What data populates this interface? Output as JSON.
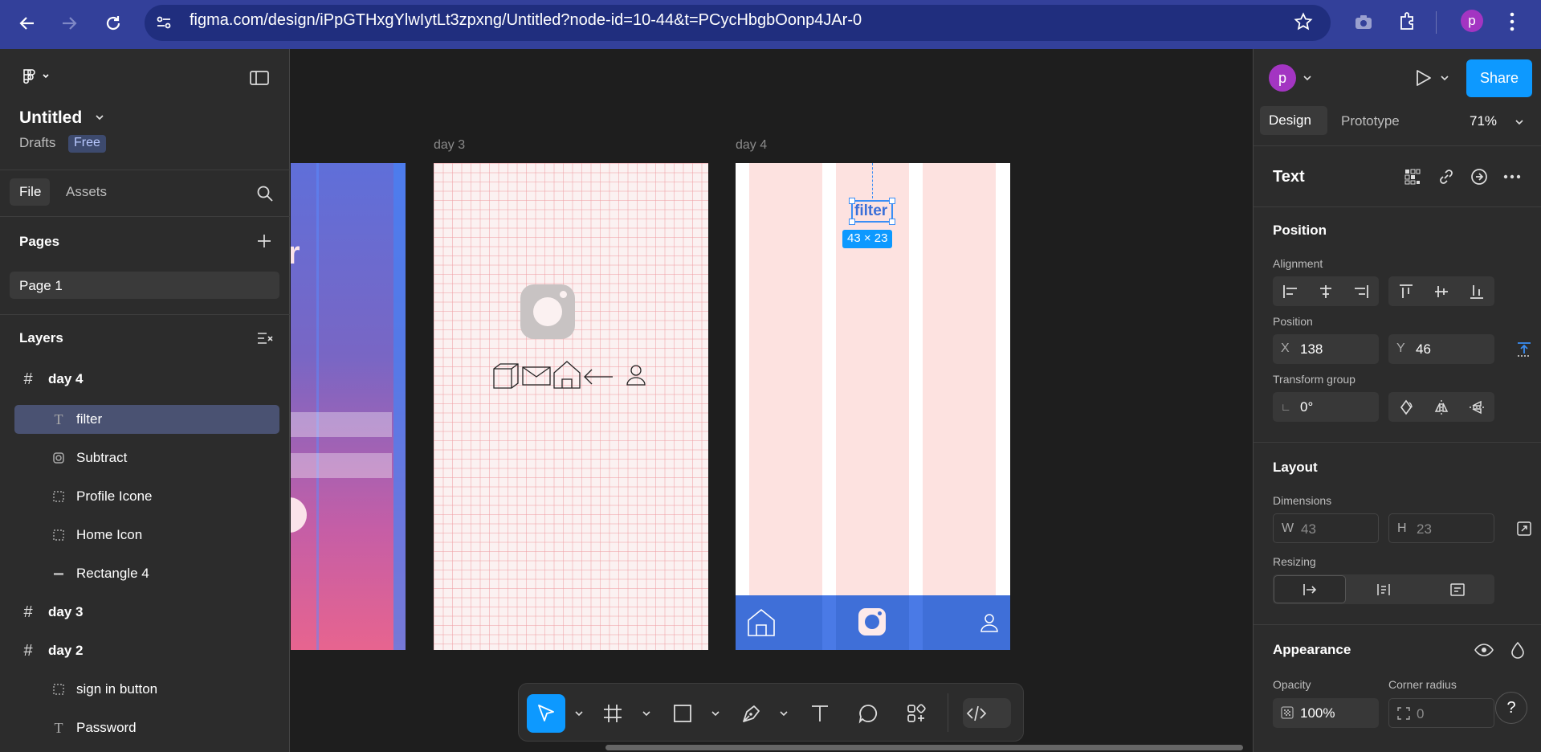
{
  "browser": {
    "url": "figma.com/design/iPpGTHxgYlwIytLt3zpxng/Untitled?node-id=10-44&t=PCycHbgbOonp4JAr-0",
    "profile_initial": "p"
  },
  "file": {
    "title": "Untitled",
    "location": "Drafts",
    "plan_badge": "Free"
  },
  "left_tabs": {
    "file": "File",
    "assets": "Assets"
  },
  "pages": {
    "heading": "Pages",
    "items": [
      {
        "label": "Page 1"
      }
    ]
  },
  "layers": {
    "heading": "Layers",
    "items": [
      {
        "label": "day 4",
        "type": "frame",
        "icon": "frame-icon"
      },
      {
        "label": "filter",
        "type": "text",
        "icon": "text-icon"
      },
      {
        "label": "Subtract",
        "type": "boolean",
        "icon": "subtract-icon"
      },
      {
        "label": "Profile Icone",
        "type": "group",
        "icon": "group-icon"
      },
      {
        "label": "Home Icon",
        "type": "group",
        "icon": "group-icon"
      },
      {
        "label": "Rectangle 4",
        "type": "rectangle",
        "icon": "rectangle-icon"
      },
      {
        "label": "day 3",
        "type": "frame",
        "icon": "frame-icon"
      },
      {
        "label": "day 2",
        "type": "frame",
        "icon": "frame-icon"
      },
      {
        "label": "sign in button",
        "type": "group",
        "icon": "group-icon"
      },
      {
        "label": "Password",
        "type": "text",
        "icon": "text-icon"
      }
    ]
  },
  "canvas": {
    "frame_day3_label": "day 3",
    "frame_day4_label": "day 4",
    "partial_text": "r",
    "selected_text": "filter",
    "size_badge": "43 × 23"
  },
  "right_panel": {
    "avatar_initial": "p",
    "share_label": "Share",
    "tabs": {
      "design": "Design",
      "prototype": "Prototype"
    },
    "zoom": "71%",
    "selection_type": "Text",
    "position_section": "Position",
    "alignment_label": "Alignment",
    "position_label": "Position",
    "x_label": "X",
    "x_value": "138",
    "y_label": "Y",
    "y_value": "46",
    "transform_label": "Transform group",
    "rotation_value": "0°",
    "layout_section": "Layout",
    "dimensions_label": "Dimensions",
    "w_label": "W",
    "w_value": "43",
    "h_label": "H",
    "h_value": "23",
    "resizing_label": "Resizing",
    "appearance_section": "Appearance",
    "opacity_label": "Opacity",
    "opacity_value": "100%",
    "corner_radius_label": "Corner radius",
    "corner_radius_value": "0",
    "help_label": "?"
  },
  "colors": {
    "browser_bar": "#33409a",
    "accent_blue": "#0d99ff",
    "selection_row": "#4a5272",
    "frame_blue": "#3f6fd8",
    "column_pink": "#fde2e0",
    "avatar_purple": "#a335c2"
  }
}
